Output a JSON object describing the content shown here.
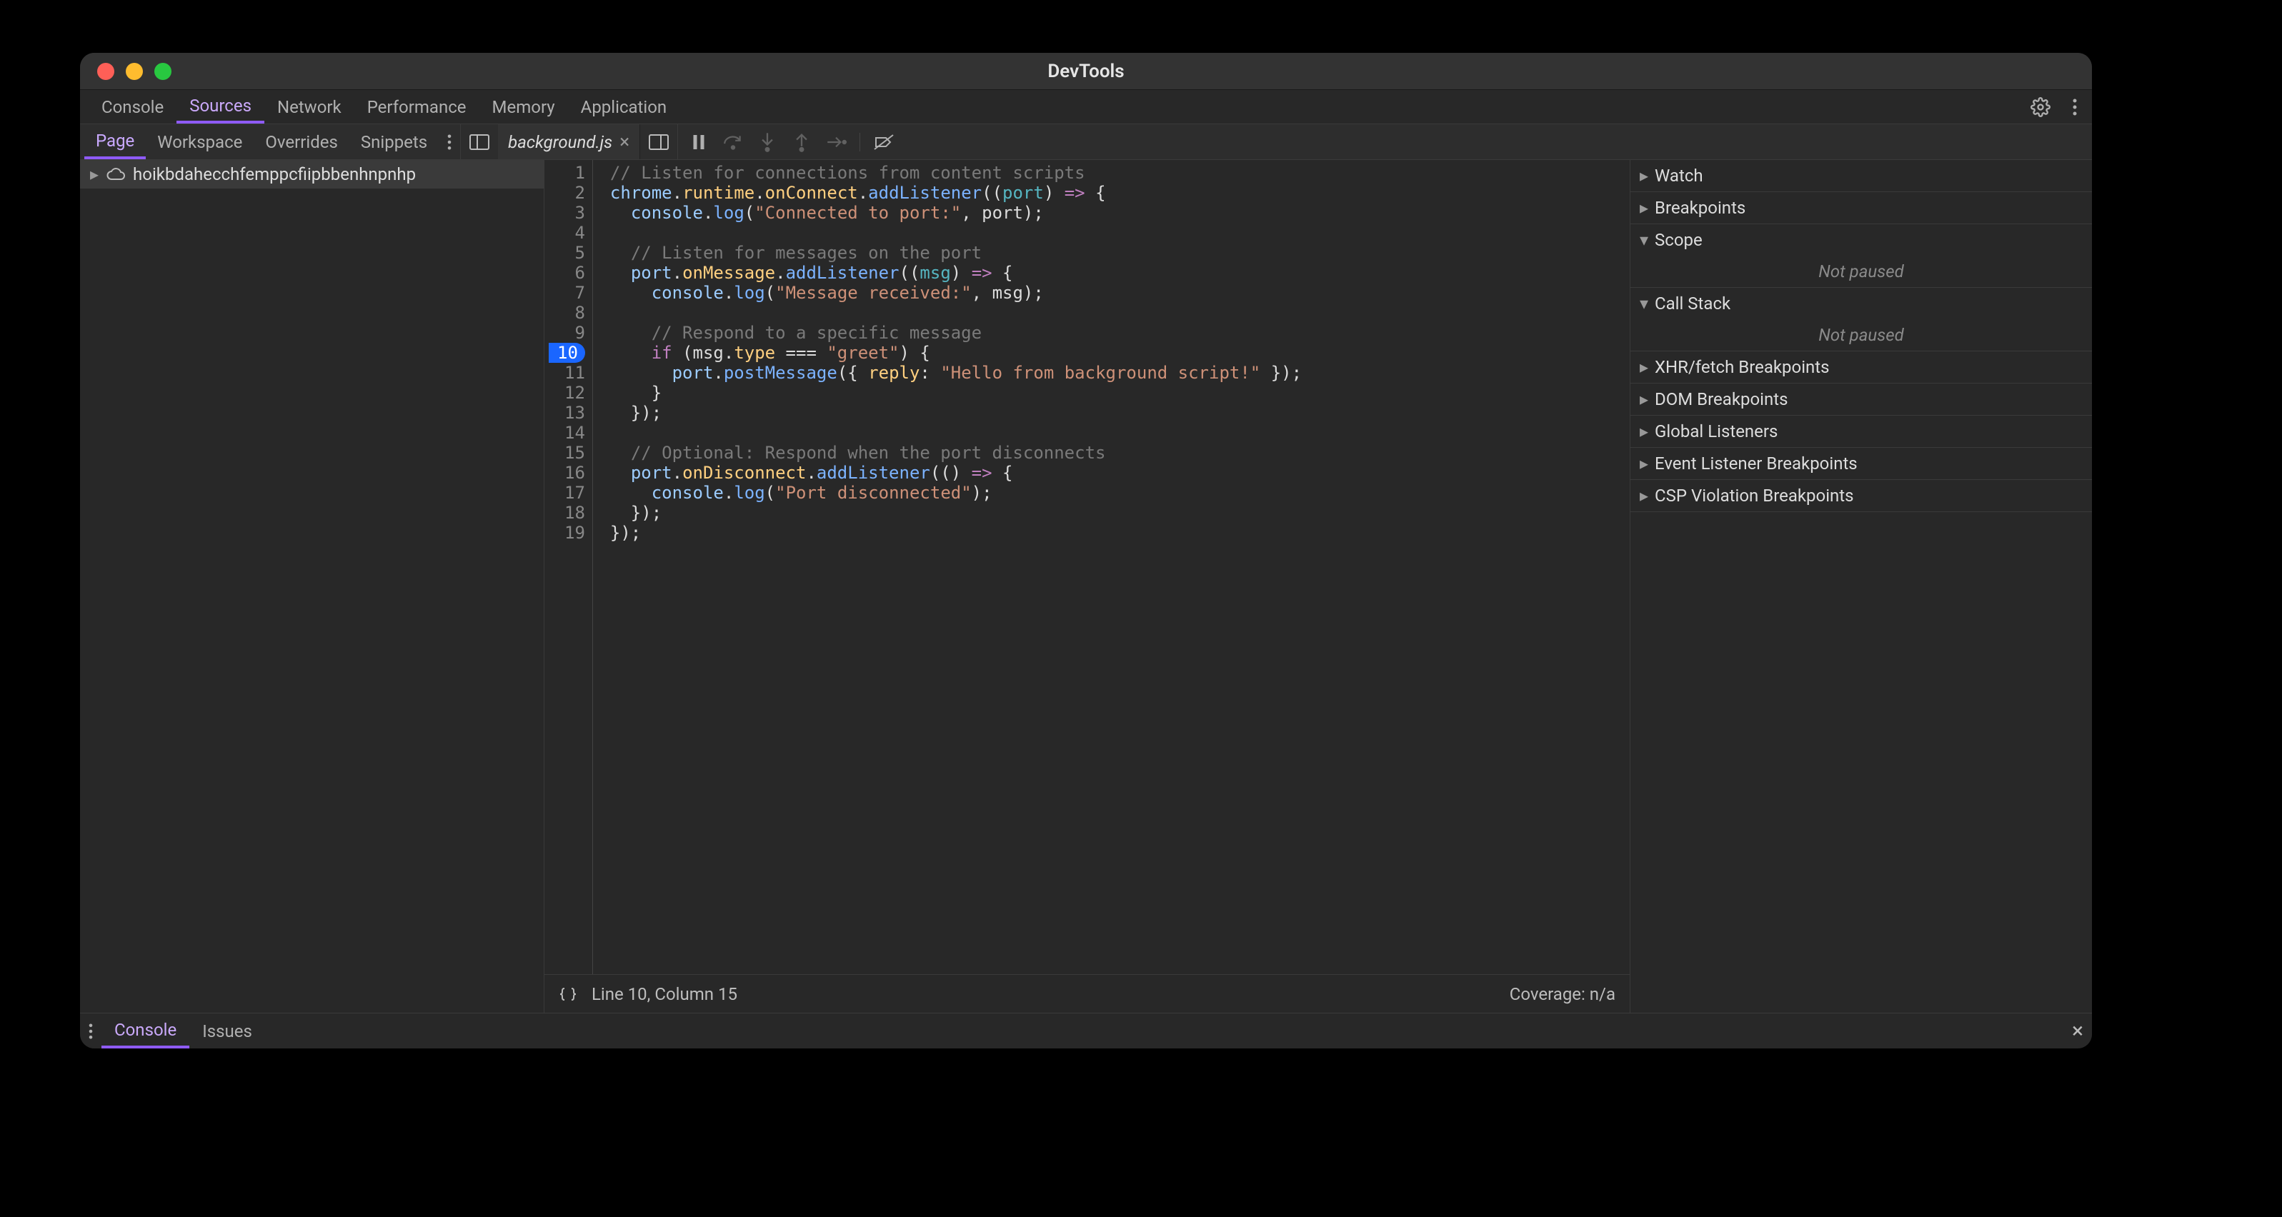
{
  "window": {
    "title": "DevTools"
  },
  "main_tabs": [
    "Console",
    "Sources",
    "Network",
    "Performance",
    "Memory",
    "Application"
  ],
  "main_tab_active_index": 1,
  "source_subtabs": [
    "Page",
    "Workspace",
    "Overrides",
    "Snippets"
  ],
  "source_subtab_active_index": 0,
  "file_tab": {
    "name": "background.js"
  },
  "tree": {
    "root": "hoikbdahecchfemppcfiipbbenhnpnhp"
  },
  "editor": {
    "breakpoint_line": 10,
    "lines": [
      [
        [
          "cm",
          "// Listen for connections from content scripts"
        ]
      ],
      [
        [
          "id",
          "chrome"
        ],
        [
          "pun",
          "."
        ],
        [
          "prop",
          "runtime"
        ],
        [
          "pun",
          "."
        ],
        [
          "prop",
          "onConnect"
        ],
        [
          "pun",
          "."
        ],
        [
          "fn",
          "addListener"
        ],
        [
          "pun",
          "(("
        ],
        [
          "var",
          "port"
        ],
        [
          "pun",
          ") "
        ],
        [
          "kw",
          "=>"
        ],
        [
          "pun",
          " {"
        ]
      ],
      [
        [
          "pun",
          "  "
        ],
        [
          "id",
          "console"
        ],
        [
          "pun",
          "."
        ],
        [
          "fn",
          "log"
        ],
        [
          "pun",
          "("
        ],
        [
          "str",
          "\"Connected to port:\""
        ],
        [
          "pun",
          ", port);"
        ]
      ],
      [],
      [
        [
          "pun",
          "  "
        ],
        [
          "cm",
          "// Listen for messages on the port"
        ]
      ],
      [
        [
          "pun",
          "  "
        ],
        [
          "id",
          "port"
        ],
        [
          "pun",
          "."
        ],
        [
          "prop",
          "onMessage"
        ],
        [
          "pun",
          "."
        ],
        [
          "fn",
          "addListener"
        ],
        [
          "pun",
          "(("
        ],
        [
          "var",
          "msg"
        ],
        [
          "pun",
          ") "
        ],
        [
          "kw",
          "=>"
        ],
        [
          "pun",
          " {"
        ]
      ],
      [
        [
          "pun",
          "    "
        ],
        [
          "id",
          "console"
        ],
        [
          "pun",
          "."
        ],
        [
          "fn",
          "log"
        ],
        [
          "pun",
          "("
        ],
        [
          "str",
          "\"Message received:\""
        ],
        [
          "pun",
          ", msg);"
        ]
      ],
      [],
      [
        [
          "pun",
          "    "
        ],
        [
          "cm",
          "// Respond to a specific message"
        ]
      ],
      [
        [
          "pun",
          "    "
        ],
        [
          "kw",
          "if"
        ],
        [
          "pun",
          " (msg."
        ],
        [
          "prop",
          "type"
        ],
        [
          "pun",
          " === "
        ],
        [
          "str",
          "\"greet\""
        ],
        [
          "pun",
          ") {"
        ]
      ],
      [
        [
          "pun",
          "      "
        ],
        [
          "id",
          "port"
        ],
        [
          "pun",
          "."
        ],
        [
          "fn",
          "postMessage"
        ],
        [
          "pun",
          "({ "
        ],
        [
          "prop",
          "reply"
        ],
        [
          "pun",
          ": "
        ],
        [
          "str",
          "\"Hello from background script!\""
        ],
        [
          "pun",
          " });"
        ]
      ],
      [
        [
          "pun",
          "    }"
        ]
      ],
      [
        [
          "pun",
          "  });"
        ]
      ],
      [],
      [
        [
          "pun",
          "  "
        ],
        [
          "cm",
          "// Optional: Respond when the port disconnects"
        ]
      ],
      [
        [
          "pun",
          "  "
        ],
        [
          "id",
          "port"
        ],
        [
          "pun",
          "."
        ],
        [
          "prop",
          "onDisconnect"
        ],
        [
          "pun",
          "."
        ],
        [
          "fn",
          "addListener"
        ],
        [
          "pun",
          "(() "
        ],
        [
          "kw",
          "=>"
        ],
        [
          "pun",
          " {"
        ]
      ],
      [
        [
          "pun",
          "    "
        ],
        [
          "id",
          "console"
        ],
        [
          "pun",
          "."
        ],
        [
          "fn",
          "log"
        ],
        [
          "pun",
          "("
        ],
        [
          "str",
          "\"Port disconnected\""
        ],
        [
          "pun",
          ");"
        ]
      ],
      [
        [
          "pun",
          "  });"
        ]
      ],
      [
        [
          "pun",
          "});"
        ]
      ]
    ]
  },
  "status": {
    "cursor": "Line 10, Column 15",
    "coverage": "Coverage: n/a"
  },
  "debugger": {
    "sections": [
      {
        "label": "Watch",
        "expanded": false
      },
      {
        "label": "Breakpoints",
        "expanded": false
      },
      {
        "label": "Scope",
        "expanded": true,
        "body": "Not paused"
      },
      {
        "label": "Call Stack",
        "expanded": true,
        "body": "Not paused"
      },
      {
        "label": "XHR/fetch Breakpoints",
        "expanded": false
      },
      {
        "label": "DOM Breakpoints",
        "expanded": false
      },
      {
        "label": "Global Listeners",
        "expanded": false
      },
      {
        "label": "Event Listener Breakpoints",
        "expanded": false
      },
      {
        "label": "CSP Violation Breakpoints",
        "expanded": false
      }
    ]
  },
  "drawer_tabs": [
    "Console",
    "Issues"
  ],
  "drawer_active_index": 0
}
